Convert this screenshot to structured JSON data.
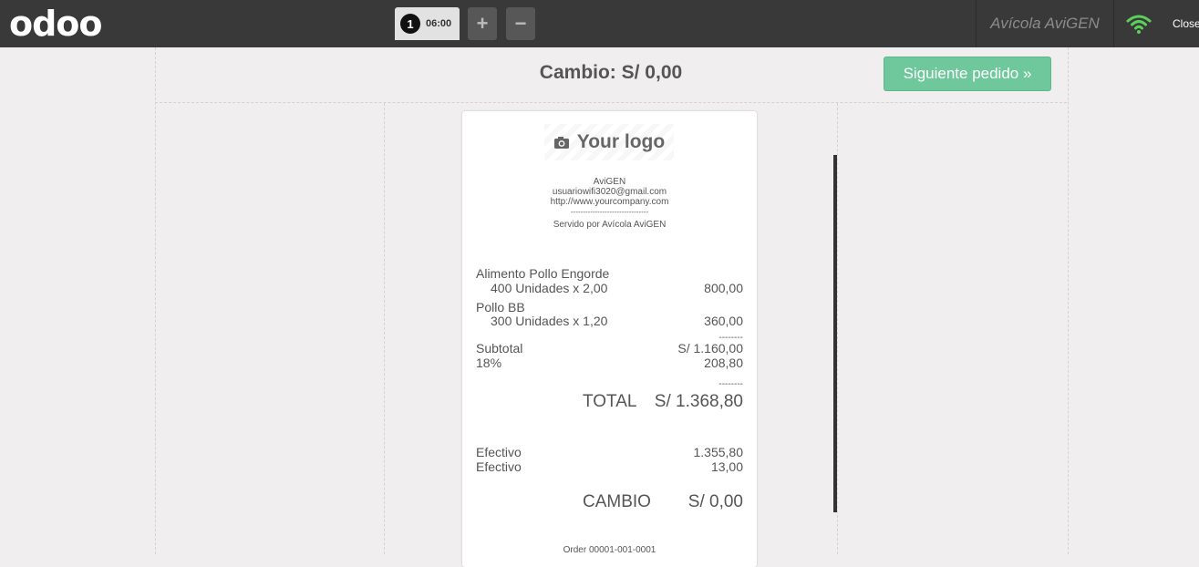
{
  "topbar": {
    "logo": "odoo",
    "order_number": "1",
    "order_time": "06:00",
    "add_tab": "+",
    "remove_tab": "−",
    "shop_name": "Avícola AviGEN",
    "close_label": "Close"
  },
  "payment": {
    "change_title": "Cambio: S/ 0,00",
    "next_order_label": "Siguiente pedido »"
  },
  "receipt": {
    "logo_text": "Your logo",
    "company": "AviGEN",
    "email": "usuariowifi3020@gmail.com",
    "website": "http://www.yourcompany.com",
    "separator": "--------------------------------",
    "served_by": "Servido por Avícola AviGEN",
    "lines": [
      {
        "product": "Alimento Pollo Engorde",
        "qty_line": "400 Unidades x 2,00",
        "amount": "800,00"
      },
      {
        "product": "Pollo BB",
        "qty_line": "300 Unidades x 1,20",
        "amount": "360,00"
      }
    ],
    "dashes": "--------",
    "subtotal_label": "Subtotal",
    "subtotal_value": "S/ 1.160,00",
    "tax_label": "18%",
    "tax_value": "208,80",
    "total_label": "TOTAL",
    "total_value": "S/ 1.368,80",
    "payments": [
      {
        "method": "Efectivo",
        "amount": "1.355,80"
      },
      {
        "method": "Efectivo",
        "amount": "13,00"
      }
    ],
    "change_label": "CAMBIO",
    "change_value": "S/ 0,00",
    "order_ref": "Order 00001-001-0001"
  },
  "colors": {
    "topbar": "#393939",
    "next_button": "#6ec89b",
    "background": "#f0eeee"
  }
}
